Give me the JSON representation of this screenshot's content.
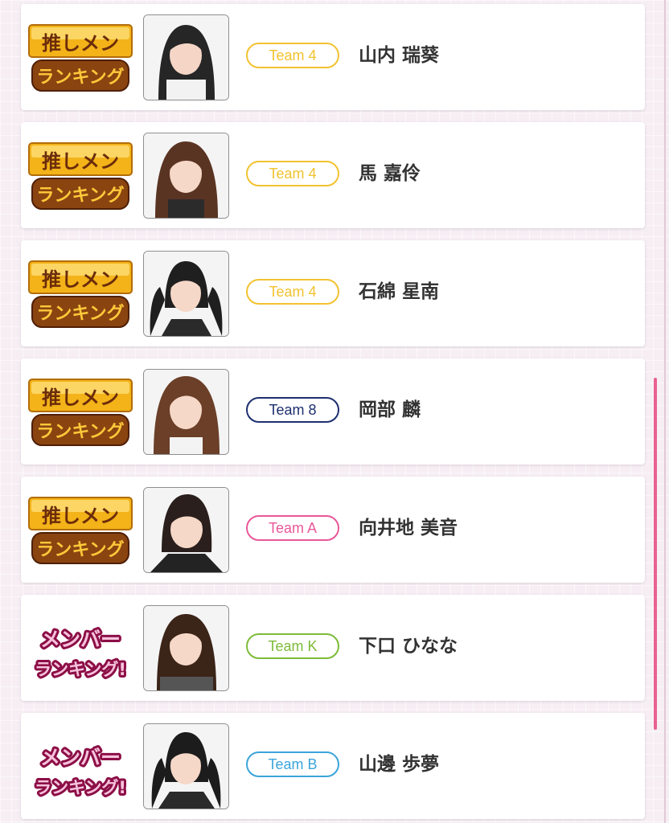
{
  "badges": {
    "oshimen": {
      "line1": "推しメン",
      "line2": "ランキング"
    },
    "member": {
      "line1": "メンバー",
      "line2": "ランキング!"
    }
  },
  "colors": {
    "team_4": "#f2c230",
    "team_8": "#1d2f6f",
    "team_a": "#e9579a",
    "team_k": "#7dbb38",
    "team_b": "#3ba4db",
    "scrollbar": "#e8618f"
  },
  "rows": [
    {
      "badge": "oshimen",
      "team": "Team 4",
      "team_color": "#f2c230",
      "name": "山内 瑞葵"
    },
    {
      "badge": "oshimen",
      "team": "Team 4",
      "team_color": "#f2c230",
      "name": "馬 嘉伶"
    },
    {
      "badge": "oshimen",
      "team": "Team 4",
      "team_color": "#f2c230",
      "name": "石綿 星南"
    },
    {
      "badge": "oshimen",
      "team": "Team 8",
      "team_color": "#1d2f6f",
      "name": "岡部 麟"
    },
    {
      "badge": "oshimen",
      "team": "Team A",
      "team_color": "#e9579a",
      "name": "向井地 美音"
    },
    {
      "badge": "member",
      "team": "Team K",
      "team_color": "#7dbb38",
      "name": "下口 ひなな"
    },
    {
      "badge": "member",
      "team": "Team B",
      "team_color": "#3ba4db",
      "name": "山邊 歩夢"
    }
  ]
}
